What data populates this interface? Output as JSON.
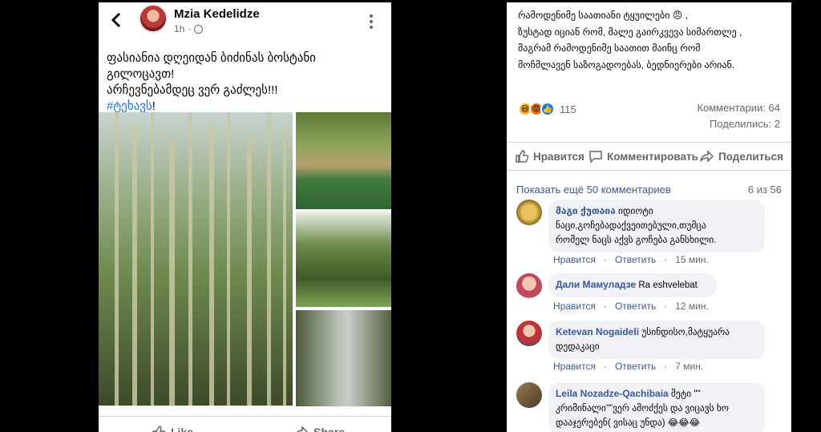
{
  "post": {
    "author": "Mzia Kedelidze",
    "time": "1h",
    "text_lines": [
      "ფასიანია  დღეიდან ბიძინას ბოსტანი",
      "გილოცავთ!",
      "არჩევნებამდეც ვერ გაძლეს!!!"
    ],
    "hashtag": "#ტეხავს",
    "hashtag_suffix": "!",
    "like_label": "Like",
    "share_label": "Share"
  },
  "panel": {
    "top_text_lines": [
      "რამოდენიმე საათიანი ტყუილები 😠 ,",
      "ზუსტად იციან რომ, მალე გაირკვევა სიმართლე ,",
      "მაგრამ რამოდენიმე საათით მაინც რომ",
      "მოჩმლავენ საზოგადოებას, ბედნიერები არიან."
    ],
    "reaction_count": "115",
    "comments_stat": "Комментарии: 64",
    "shares_stat": "Поделились: 2",
    "like_label": "Нравится",
    "comment_label": "Комментировать",
    "share_label": "Поделиться",
    "more_comments": "Показать ещё 50 комментариев",
    "comment_count": "6 из 56"
  },
  "comments": [
    {
      "name": "მაგი ქუთაია",
      "text_inline": "იდიოტი",
      "text_lines": [
        "ნაცი,გოჩებადაქვეითებული,თუმცა",
        "რომელ ნაცს აქვს გოჩება განსხილი."
      ],
      "like": "Нравится",
      "reply": "Ответить",
      "time": "15 мин."
    },
    {
      "name": "Дали Мамуладзе",
      "text_inline": "Ra eshvelebat",
      "text_lines": [],
      "like": "Нравится",
      "reply": "Ответить",
      "time": "12 мин."
    },
    {
      "name": "Ketevan Nogaideli",
      "text_inline": "უსინდისო,მატყუარა",
      "text_lines": [
        "დედაკაცი"
      ],
      "like": "Нравится",
      "reply": "Ответить",
      "time": "7 мин."
    },
    {
      "name": "Leila Nozadze-Qachibaia",
      "text_inline": "მეტი \"\"",
      "text_lines": [
        "კრიმინალი\"\"ვერ ამოძქეს და ვიცავს ხო",
        "დააჯერებენ( ვისაც უნდა) 😂😂😂"
      ]
    }
  ],
  "colors": {
    "link": "#385898",
    "muted": "#65676b",
    "bubble": "#f0f2f5",
    "like_blue": "#1877f2"
  }
}
